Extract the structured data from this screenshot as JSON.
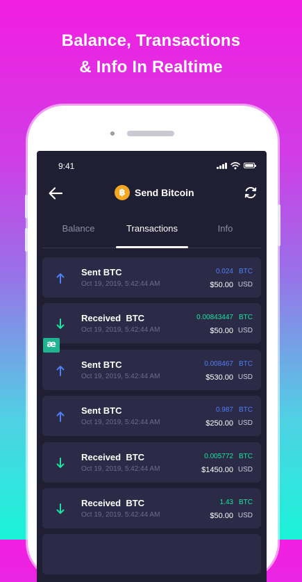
{
  "headline": {
    "line1": "Balance, Transactions",
    "line2": "& Info In Realtime"
  },
  "status_bar": {
    "time": "9:41"
  },
  "app_bar": {
    "title": "Send Bitcoin",
    "coin_symbol": "฿",
    "back_icon": "arrow-left-icon",
    "refresh_icon": "refresh-icon"
  },
  "tabs": [
    {
      "label": "Balance",
      "active": false
    },
    {
      "label": "Transactions",
      "active": true
    },
    {
      "label": "Info",
      "active": false
    }
  ],
  "colors": {
    "sent_accent": "#4f7df5",
    "received_accent": "#19e3a0",
    "coin": "#f5a623",
    "card": "#2c2b47",
    "screen": "#1f1e33"
  },
  "transactions": [
    {
      "type": "sent",
      "title": "Sent BTC",
      "date": "Oct 19, 2019, 5:42:44 AM",
      "btc_amount": "0.024",
      "btc_unit": "BTC",
      "usd_amount": "$50.00",
      "usd_unit": "USD"
    },
    {
      "type": "received",
      "title": "Received  BTC",
      "date": "Oct 19, 2019, 5:42:44 AM",
      "btc_amount": "0.00843447",
      "btc_unit": "BTC",
      "usd_amount": "$50.00",
      "usd_unit": "USD"
    },
    {
      "type": "sent",
      "title": "Sent BTC",
      "date": "Oct 19, 2019, 5:42:44 AM",
      "btc_amount": "0.008467",
      "btc_unit": "BTC",
      "usd_amount": "$530.00",
      "usd_unit": "USD"
    },
    {
      "type": "sent",
      "title": "Sent BTC",
      "date": "Oct 19, 2019, 5:42:44 AM",
      "btc_amount": "0.987",
      "btc_unit": "BTC",
      "usd_amount": "$250.00",
      "usd_unit": "USD"
    },
    {
      "type": "received",
      "title": "Received  BTC",
      "date": "Oct 19, 2019, 5:42:44 AM",
      "btc_amount": "0.005772",
      "btc_unit": "BTC",
      "usd_amount": "$1450.00",
      "usd_unit": "USD"
    },
    {
      "type": "received",
      "title": "Received  BTC",
      "date": "Oct 19, 2019, 5:42:44 AM",
      "btc_amount": "1.43",
      "btc_unit": "BTC",
      "usd_amount": "$50.00",
      "usd_unit": "USD"
    }
  ],
  "badge": {
    "text": "æ"
  }
}
